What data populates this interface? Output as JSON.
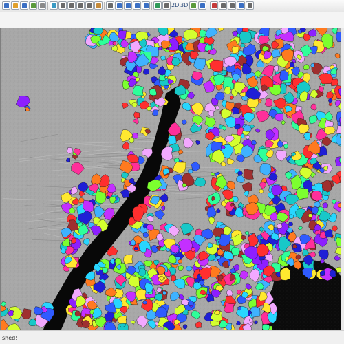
{
  "toolbar": {
    "buttons": [
      {
        "name": "new-icon"
      },
      {
        "name": "open-icon"
      },
      {
        "name": "save-icon"
      },
      {
        "name": "layer-icon"
      },
      {
        "name": "shape-icon"
      },
      {
        "name": "cloud-icon"
      },
      {
        "name": "zoom-extent-icon"
      },
      {
        "name": "zoom-in-icon"
      },
      {
        "name": "zoom-out-icon"
      },
      {
        "name": "zoom-window-icon"
      },
      {
        "name": "pan-icon"
      },
      {
        "name": "rotate-icon"
      },
      {
        "name": "select-icon"
      },
      {
        "name": "identify-icon"
      },
      {
        "name": "measure-icon"
      },
      {
        "name": "table-icon"
      },
      {
        "name": "globe-icon"
      },
      {
        "name": "filter-icon"
      },
      {
        "name": "view-2d-icon"
      },
      {
        "name": "view-3d-icon"
      },
      {
        "name": "grid-icon"
      },
      {
        "name": "profile-icon"
      },
      {
        "name": "classify-icon"
      },
      {
        "name": "export-icon"
      },
      {
        "name": "settings-icon"
      },
      {
        "name": "help-icon"
      },
      {
        "name": "window-icon"
      }
    ],
    "label_2d": "2D",
    "label_3d": "3D"
  },
  "status": {
    "text": "shed!"
  },
  "colors": {
    "ground": "#a9a9a9",
    "water": "#080808",
    "tree_palette": [
      "#ff2f9a",
      "#2f5bff",
      "#1f1fd6",
      "#28d6ff",
      "#7cff2f",
      "#ffe82f",
      "#ff7a1f",
      "#ff2f2f",
      "#c42fff",
      "#2fff9a",
      "#d4ff2f",
      "#9f2f2f",
      "#f2a8ff",
      "#3fb2ff",
      "#8d1fff",
      "#18c8c8"
    ]
  }
}
